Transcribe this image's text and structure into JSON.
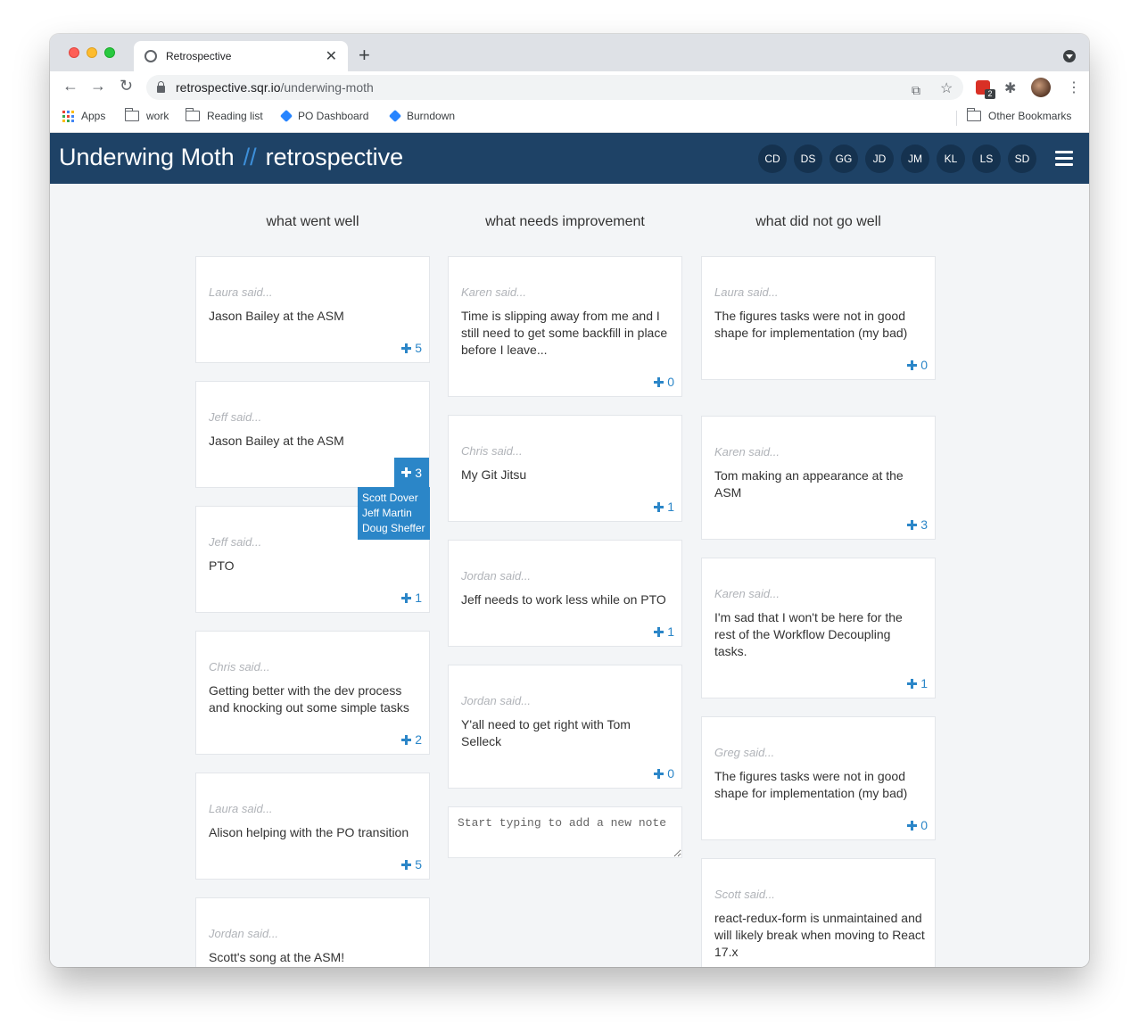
{
  "browser": {
    "tab_title": "Retrospective",
    "url_host": "retrospective.sqr.io",
    "url_path": "/underwing-moth",
    "bookmarks": [
      {
        "label": "Apps",
        "icon": "apps-grid-icon"
      },
      {
        "label": "work",
        "icon": "folder-icon"
      },
      {
        "label": "Reading list",
        "icon": "folder-icon"
      },
      {
        "label": "PO Dashboard",
        "icon": "jira-icon"
      },
      {
        "label": "Burndown",
        "icon": "jira-icon"
      }
    ],
    "other_bookmarks": "Other Bookmarks",
    "extension_badge": "2"
  },
  "app": {
    "team": "Underwing Moth",
    "separator": "//",
    "page": "retrospective",
    "participants": [
      "CD",
      "DS",
      "GG",
      "JD",
      "JM",
      "KL",
      "LS",
      "SD"
    ],
    "header_color": "#1e4266",
    "accent_color": "#2b86c8"
  },
  "columns": [
    {
      "title": "what went well",
      "cards": [
        {
          "author": "Laura said...",
          "text": "Jason Bailey at the ASM",
          "votes": "5"
        },
        {
          "author": "Jeff said...",
          "text": "Jason Bailey at the ASM",
          "votes": "3"
        },
        {
          "author": "Jeff said...",
          "text": "PTO",
          "votes": "1"
        },
        {
          "author": "Chris said...",
          "text": "Getting better with the dev process and knocking out some simple tasks",
          "votes": "2"
        },
        {
          "author": "Laura said...",
          "text": "Alison helping with the PO transition",
          "votes": "5"
        },
        {
          "author": "Jordan said...",
          "text": "Scott's song at the ASM!",
          "votes": ""
        }
      ],
      "tooltip_voters": [
        "Scott Dover",
        "Jeff Martin",
        "Doug Sheffer"
      ]
    },
    {
      "title": "what needs improvement",
      "cards": [
        {
          "author": "Karen said...",
          "text": "Time is slipping away from me and I still need to get some backfill in place before I leave...",
          "votes": "0"
        },
        {
          "author": "Chris said...",
          "text": "My Git Jitsu",
          "votes": "1"
        },
        {
          "author": "Jordan said...",
          "text": "Jeff needs to work less while on PTO",
          "votes": "1"
        },
        {
          "author": "Jordan said...",
          "text": "Y'all need to get right with Tom Selleck",
          "votes": "0"
        }
      ],
      "new_note_placeholder": "Start typing to add a new note"
    },
    {
      "title": "what did not go well",
      "cards": [
        {
          "author": "Laura said...",
          "text": "The figures tasks were not in good shape for implementation (my bad)",
          "votes": "0"
        },
        {
          "author": "Karen said...",
          "text": "Tom making an appearance at the ASM",
          "votes": "3"
        },
        {
          "author": "Karen said...",
          "text": "I'm sad that I won't be here for the rest of the Workflow Decoupling tasks.",
          "votes": "1"
        },
        {
          "author": "Greg said...",
          "text": "The figures tasks were not in good shape for implementation (my bad)",
          "votes": "0"
        },
        {
          "author": "Scott said...",
          "text": "react-redux-form is unmaintained and will likely break when moving to React 17.x",
          "votes": ""
        }
      ]
    }
  ]
}
